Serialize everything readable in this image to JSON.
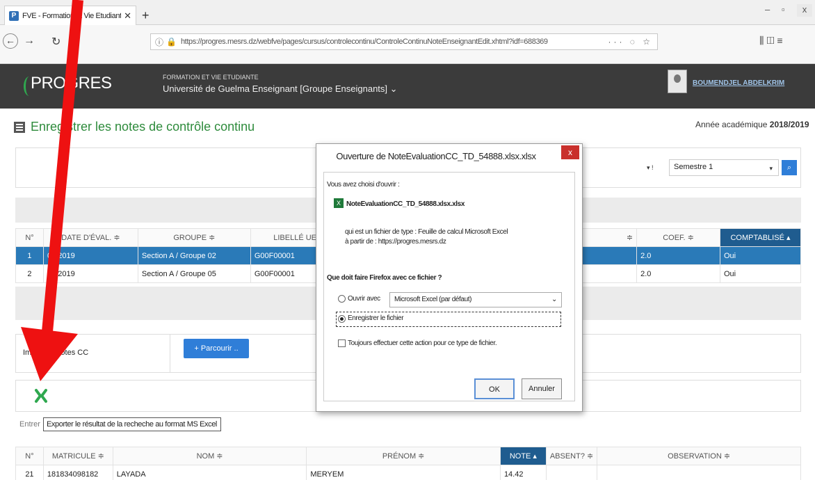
{
  "browser": {
    "tab_title": "FVE - Formation et Vie Etudiante",
    "tab_close": "✕",
    "new_tab": "+",
    "url": "https://progres.mesrs.dz/webfve/pages/cursus/controlecontinu/ControleContinuNoteEnseignantEdit.xhtml?idf=688369",
    "url_tools": "··· ◌ ☆",
    "right_tools": "⫼  ◫  ≡",
    "win_min": "–",
    "win_max": "▫",
    "win_close": "x"
  },
  "app": {
    "logo": "PROGRES",
    "subtitle_small": "FORMATION ET VIE ETUDIANTE",
    "subtitle": "Université de Guelma Enseignant [Groupe Enseignants] ⌄",
    "username": "BOUMENDJEL ABDELKRIM"
  },
  "page": {
    "title": "Enregistrer les notes de contrôle continu",
    "year_label": "Année académique",
    "year_value": "2018/2019",
    "semester": "Semestre 1"
  },
  "eval_table": {
    "headers": [
      "N°",
      "DATE D'ÉVAL. ≑",
      "GROUPE ≑",
      "LIBELLÉ UE ≑",
      "≑",
      "COEF. ≑",
      "COMPTABLISÉ ▴"
    ],
    "rows": [
      {
        "n": "1",
        "date": "02/2019",
        "groupe": "Section A / Groupe 02",
        "ue": "G00F00001",
        "coef": "2.0",
        "comptabilise": "Oui"
      },
      {
        "n": "2",
        "date": "02/2019",
        "groupe": "Section A / Groupe 05",
        "ue": "G00F00001",
        "coef": "2.0",
        "comptabilise": "Oui"
      }
    ]
  },
  "import": {
    "label": "Impo des notes CC",
    "browse_label": "+ Parcourir .."
  },
  "export": {
    "entrer": "Entrer",
    "tooltip": "Exporter le résultat de la recheche au format MS Excel"
  },
  "notes_table": {
    "headers": [
      "N°",
      "MATRICULE ≑",
      "NOM ≑",
      "PRÉNOM ≑",
      "NOTE ▴",
      "ABSENT? ≑",
      "OBSERVATION ≑"
    ],
    "row": {
      "n": "21",
      "matricule": "181834098182",
      "nom": "LAYADA",
      "prenom": "MERYEM",
      "note": "14.42"
    }
  },
  "dialog": {
    "title": "Ouverture de NoteEvaluationCC_TD_54888.xlsx.xlsx",
    "close": "x",
    "chosen": "Vous avez choisi d'ouvrir :",
    "filename": "NoteEvaluationCC_TD_54888.xlsx.xlsx",
    "filetype": "qui est un fichier de type : Feuille de calcul Microsoft Excel",
    "from": "à partir de : https://progres.mesrs.dz",
    "question": "Que doit faire Firefox avec ce fichier ?",
    "open_with_label": "Ouvrir avec",
    "open_with_app": "Microsoft Excel (par défaut)",
    "save_file": "Enregistrer le fichier",
    "always": "Toujours effectuer cette action pour ce type de fichier.",
    "ok": "OK",
    "cancel": "Annuler"
  },
  "colors": {
    "header_bg": "#3b3b3b",
    "title_green": "#2e8b3c",
    "selected_row": "#2a7ab8",
    "accent_blue": "#2f7ed8",
    "arrow_red": "#ee1111"
  }
}
